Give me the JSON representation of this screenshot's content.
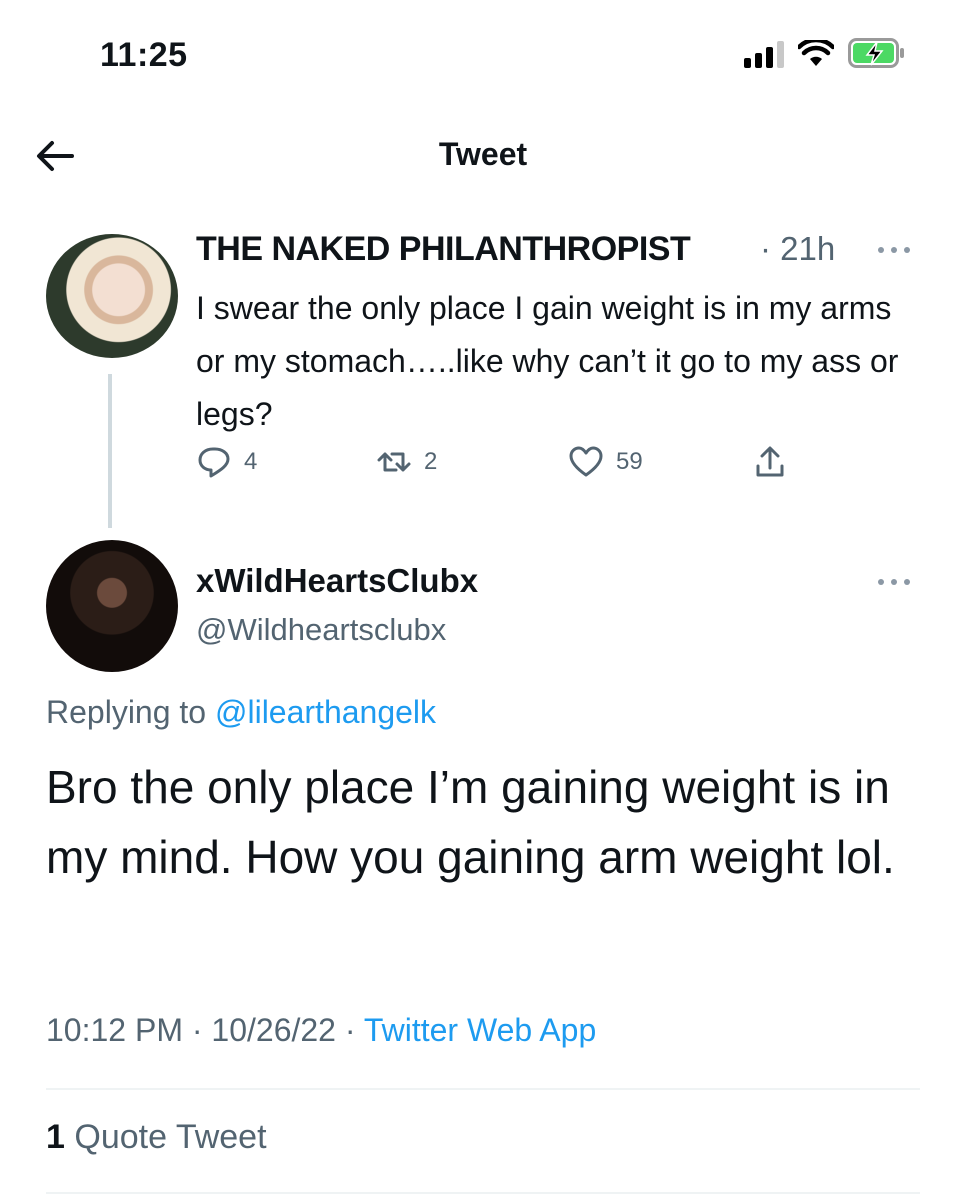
{
  "status_bar": {
    "time": "11:25",
    "icons": [
      "signal-icon",
      "wifi-icon",
      "battery-charging-icon"
    ]
  },
  "header": {
    "back_icon": "arrow-left-icon",
    "title": "Tweet"
  },
  "parent_tweet": {
    "display_name": "THE NAKED PHILANTHROPIST",
    "time": "· 21h",
    "text": "I swear the only place I gain weight is in my arms or my stomach…..like why can’t it go to my ass or legs?",
    "actions": {
      "replies": "4",
      "retweets": "2",
      "likes": "59"
    }
  },
  "main_tweet": {
    "display_name": "xWildHeartsClubx",
    "handle": "@Wildheartsclubx",
    "replying_prefix": "Replying to",
    "replying_to": "@lilearthangelk",
    "text": "Bro the only place I’m gaining weight is in my mind. How you gaining arm weight lol.",
    "timestamp": "10:12 PM · 10/26/22 ·",
    "source": "Twitter Web App",
    "quote_count": "1",
    "quote_label": "Quote Tweet"
  },
  "colors": {
    "accent": "#1d9bf0",
    "secondary_text": "#536471",
    "primary_text": "#0f1419",
    "battery": "#4cd964"
  }
}
